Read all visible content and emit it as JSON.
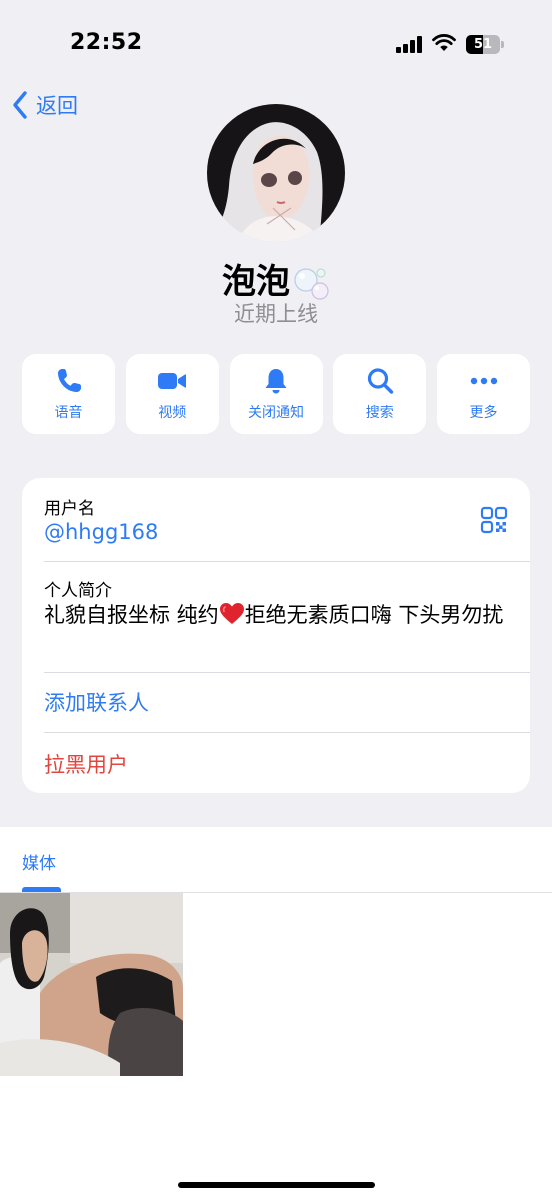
{
  "status_bar": {
    "time": "22:52",
    "battery_level": 51,
    "battery_text": "51"
  },
  "nav": {
    "back_label": "返回"
  },
  "profile": {
    "name": "泡泡",
    "presence": "近期上线"
  },
  "actions": [
    {
      "icon": "phone-icon",
      "label": "语音"
    },
    {
      "icon": "video-camera-icon",
      "label": "视频"
    },
    {
      "icon": "bell-icon",
      "label": "关闭通知"
    },
    {
      "icon": "search-icon",
      "label": "搜索"
    },
    {
      "icon": "more-dots-icon",
      "label": "更多"
    }
  ],
  "info": {
    "username_label": "用户名",
    "username": "@hhgg168",
    "bio_label": "个人简介",
    "bio_part1": "礼貌自报坐标 纯约",
    "bio_part2": "拒绝无素质口嗨 下头男勿扰",
    "add_contact": "添加联系人",
    "block_user": "拉黑用户"
  },
  "media": {
    "tab_label": "媒体"
  },
  "colors": {
    "accent": "#2f7bf5",
    "danger": "#e0463f",
    "background": "#efeff4"
  }
}
